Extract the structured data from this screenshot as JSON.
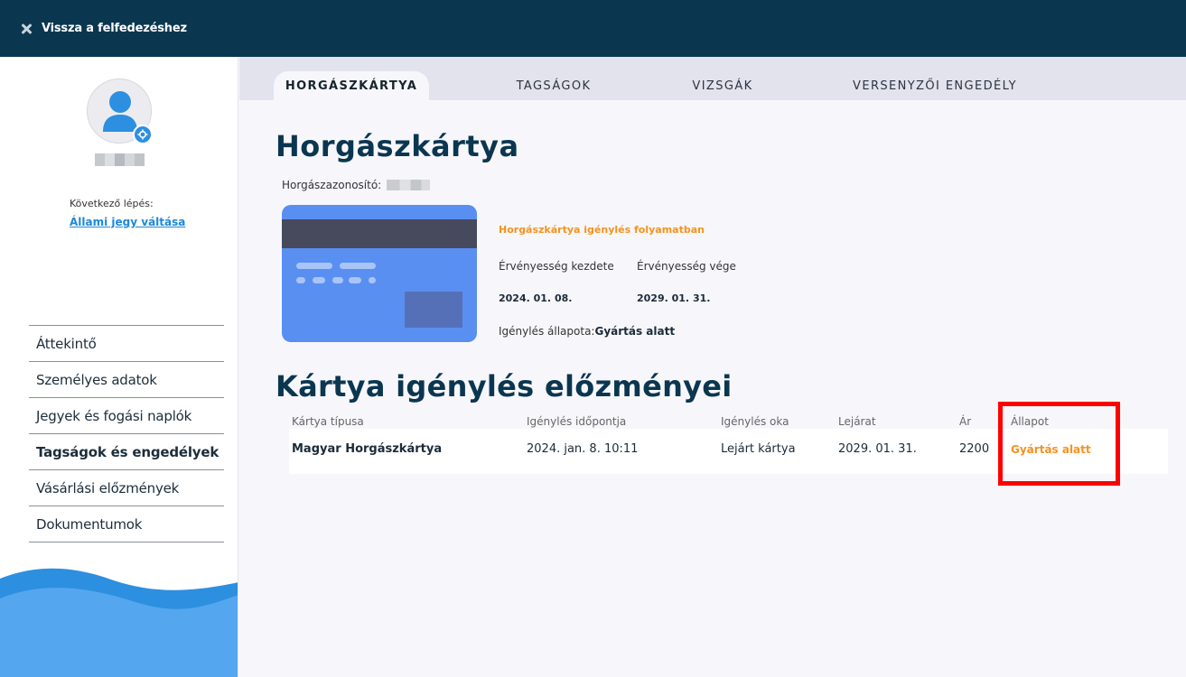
{
  "header": {
    "back_label": "Vissza a felfedezéshez"
  },
  "sidebar": {
    "next_step_label": "Következő lépés:",
    "next_step_link": "Állami jegy váltása",
    "nav": [
      {
        "label": "Áttekintő",
        "active": false
      },
      {
        "label": "Személyes adatok",
        "active": false
      },
      {
        "label": "Jegyek és fogási naplók",
        "active": false
      },
      {
        "label": "Tagságok és engedélyek",
        "active": true
      },
      {
        "label": "Vásárlási előzmények",
        "active": false
      },
      {
        "label": "Dokumentumok",
        "active": false
      }
    ]
  },
  "tabs": [
    {
      "label": "HORGÁSZKÁRTYA",
      "active": true
    },
    {
      "label": "TAGSÁGOK",
      "active": false
    },
    {
      "label": "VIZSGÁK",
      "active": false
    },
    {
      "label": "VERSENYZŐI ENGEDÉLY",
      "active": false
    }
  ],
  "card_section": {
    "title": "Horgászkártya",
    "id_label": "Horgászazonosító:",
    "status_title": "Horgászkártya igénylés folyamatban",
    "valid_from_label": "Érvényesség kezdete",
    "valid_to_label": "Érvényesség vége",
    "valid_from": "2024. 01. 08.",
    "valid_to": "2029. 01. 31.",
    "state_label": "Igénylés állapota:",
    "state_value": "Gyártás alatt"
  },
  "history": {
    "title": "Kártya igénylés előzményei",
    "columns": [
      "Kártya típusa",
      "Igénylés időpontja",
      "Igénylés oka",
      "Lejárat",
      "Ár",
      "Állapot"
    ],
    "rows": [
      [
        "Magyar Horgászkártya",
        "2024. jan. 8. 10:11",
        "Lejárt kártya",
        "2029. 01. 31.",
        "2200",
        "Gyártás alatt"
      ]
    ]
  },
  "colors": {
    "header_bg": "#0b3650",
    "accent_orange": "#f5921e",
    "link_blue": "#1e88d8",
    "card_blue": "#5a8ff2",
    "highlight_red": "#ff0000"
  }
}
